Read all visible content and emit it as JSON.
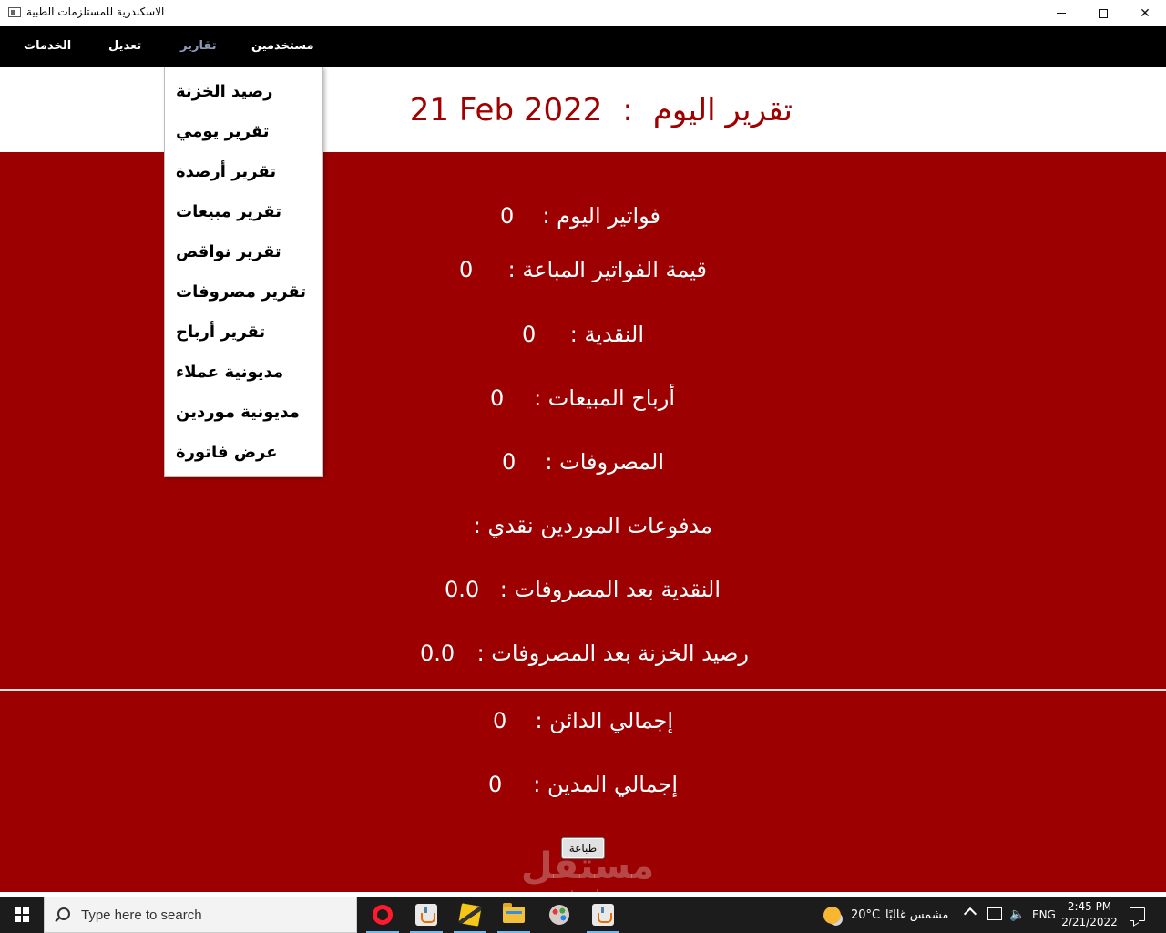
{
  "window": {
    "title": "الاسكندرية للمستلزمات الطبية"
  },
  "menubar": {
    "items": [
      {
        "label": "الخدمات",
        "active": false
      },
      {
        "label": "تعديل",
        "active": false
      },
      {
        "label": "تقارير",
        "active": true
      },
      {
        "label": "مستخدمين",
        "active": false
      }
    ]
  },
  "report": {
    "title_label": "تقرير اليوم",
    "separator": ":",
    "date": "21 Feb 2022"
  },
  "dropdown": {
    "items": [
      "رصيد الخزنة",
      "تقرير يومي",
      "تقرير أرصدة",
      "تقرير مبيعات",
      "تقرير نواقص",
      "تقرير مصروفات",
      "تقرير أرباح",
      "مديونية عملاء",
      "مديونية موردين",
      "عرض فاتورة"
    ]
  },
  "stats": [
    {
      "label": "فواتير اليوم :",
      "value": "0"
    },
    {
      "label": "قيمة الفواتير المباعة :",
      "value": "0"
    },
    {
      "label": "النقدية :",
      "value": "0"
    },
    {
      "label": "أرباح المبيعات :",
      "value": "0"
    },
    {
      "label": "المصروفات :",
      "value": "0"
    },
    {
      "label": "مدفوعات الموردين نقدي :",
      "value": ""
    },
    {
      "label": "النقدية بعد المصروفات :",
      "value": "0.0"
    },
    {
      "label": "رصيد الخزنة بعد المصروفات :",
      "value": "0.0"
    }
  ],
  "totals": [
    {
      "label": "إجمالي الدائن :",
      "value": "0"
    },
    {
      "label": "إجمالي المدين :",
      "value": "0"
    }
  ],
  "print_button": {
    "label": "طباعة"
  },
  "watermark": {
    "top": "مستقل",
    "bottom": "mostaql.com"
  },
  "taskbar": {
    "search_placeholder": "Type here to search",
    "weather_temp": "20°C",
    "weather_desc": "مشمس غالبًا",
    "language": "ENG",
    "time": "2:45 PM",
    "date": "2/21/2022"
  },
  "colors": {
    "panel": "#9c0000",
    "title_text": "#a00000",
    "menubar": "#000000",
    "active_menu": "#8e9bb8"
  }
}
